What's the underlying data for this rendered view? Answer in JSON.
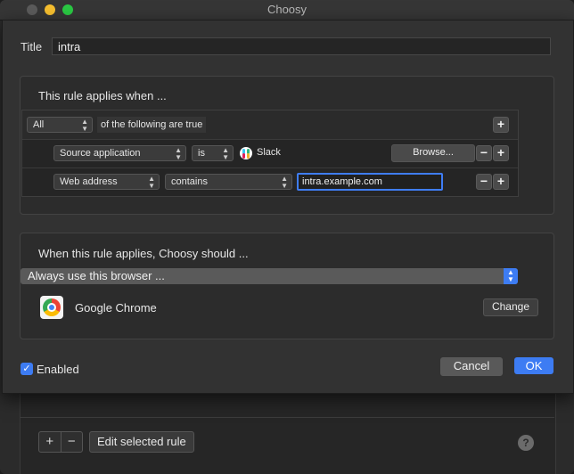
{
  "window": {
    "title": "Choosy"
  },
  "sheet": {
    "title_label": "Title",
    "title_value": "intra",
    "conditions": {
      "heading": "This rule applies when ...",
      "match_mode": "All",
      "match_suffix": "of the following are true",
      "rows": [
        {
          "field": "Source application",
          "operator": "is",
          "value": "Slack",
          "browse_label": "Browse..."
        },
        {
          "field": "Web address",
          "operator": "contains",
          "value": "intra.example.com"
        }
      ],
      "add_symbol": "+",
      "remove_symbol": "−"
    },
    "action": {
      "heading": "When this rule applies, Choosy should ...",
      "selected": "Always use this browser ...",
      "browser_name": "Google Chrome",
      "change_label": "Change"
    },
    "enabled_label": "Enabled",
    "enabled_checked": true,
    "cancel_label": "Cancel",
    "ok_label": "OK"
  },
  "background": {
    "add_symbol": "+",
    "remove_symbol": "−",
    "edit_label": "Edit selected rule",
    "help_symbol": "?"
  },
  "colors": {
    "accent": "#3d7cf3"
  }
}
